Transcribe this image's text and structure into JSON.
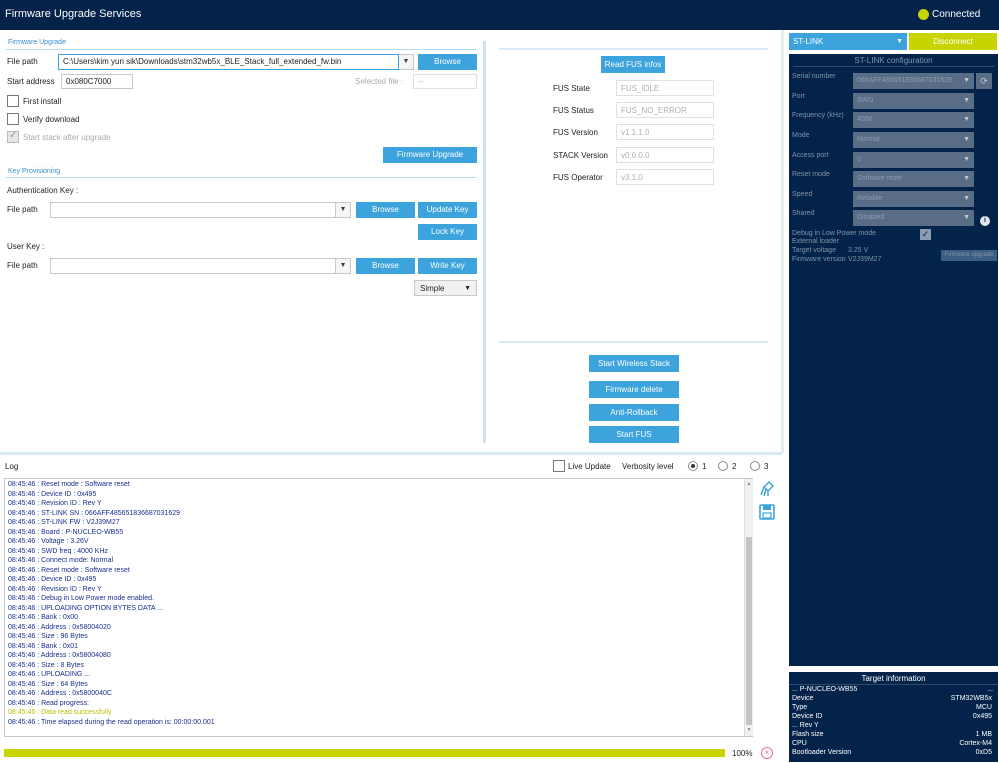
{
  "titlebar": {
    "title": "Firmware Upgrade Services",
    "status": "Connected"
  },
  "firmware_upgrade": {
    "section": "Firmware Upgrade",
    "file_path_label": "File path",
    "file_path_value": "C:\\Users\\kim yun sik\\Downloads\\stm32wb5x_BLE_Stack_full_extended_fw.bin",
    "browse": "Browse",
    "start_address_label": "Start address",
    "start_address_value": "0x080C7000",
    "selected_file_label": "Selected file :",
    "selected_file_value": "--",
    "first_install": "First install",
    "verify_download": "Verify download",
    "start_stack": "Start stack after upgrade",
    "upgrade_btn": "Firmware Upgrade"
  },
  "key_provisioning": {
    "section": "Key Provisioning",
    "auth_key_label": "Authentication Key :",
    "file_path_label": "File path",
    "browse": "Browse",
    "update_key": "Update Key",
    "lock_key": "Lock Key",
    "user_key_label": "User Key :",
    "file_path_label2": "File path",
    "browse2": "Browse",
    "write_key": "Write Key",
    "mode": "Simple"
  },
  "fus": {
    "read_btn": "Read FUS infos",
    "rows": [
      {
        "label": "FUS State",
        "value": "FUS_IDLE"
      },
      {
        "label": "FUS Status",
        "value": "FUS_NO_ERROR"
      },
      {
        "label": "FUS Version",
        "value": "v1.1.1.0"
      },
      {
        "label": "STACK Version",
        "value": "v0.0.0.0"
      },
      {
        "label": "FUS Operator",
        "value": "v3.1.0"
      }
    ],
    "start_wireless": "Start Wireless Stack",
    "fw_delete": "Firmware delete",
    "anti_rollback": "Anti-Rollback",
    "start_fus": "Start FUS"
  },
  "stlink": {
    "interface": "ST-LINK",
    "disconnect": "Disconnect",
    "config_title": "ST-LINK configuration",
    "fields": [
      {
        "label": "Serial number",
        "value": "066AFF485651836687031629"
      },
      {
        "label": "Port",
        "value": "SWD"
      },
      {
        "label": "Frequency (kHz)",
        "value": "4000"
      },
      {
        "label": "Mode",
        "value": "Normal"
      },
      {
        "label": "Access port",
        "value": "0"
      },
      {
        "label": "Reset mode",
        "value": "Software reset"
      },
      {
        "label": "Speed",
        "value": "Reliable"
      },
      {
        "label": "Shared",
        "value": "Disabled"
      }
    ],
    "debug_low_power": "Debug in Low Power mode",
    "external_loader": "External loader",
    "target_voltage_label": "Target voltage",
    "target_voltage_value": "3.25 V",
    "fw_version_label": "Firmware version",
    "fw_version_value": "V2J39M27",
    "fw_upgrade_btn": "Firmware upgrade"
  },
  "target_info": {
    "title": "Target information",
    "board_label": "...",
    "board": "P-NUCLEO-WB55",
    "board_trail": "...",
    "rows": [
      {
        "label": "Device",
        "value": "STM32WB5x"
      },
      {
        "label": "Type",
        "value": "MCU"
      },
      {
        "label": "Device ID",
        "value": "0x495"
      },
      {
        "label": "... Rev Y",
        "value": ""
      },
      {
        "label": "Flash size",
        "value": "1 MB"
      },
      {
        "label": "CPU",
        "value": "Cortex-M4"
      },
      {
        "label": "Bootloader Version",
        "value": "0xD5"
      }
    ]
  },
  "log": {
    "title": "Log",
    "live_update": "Live Update",
    "verbosity": "Verbosity level",
    "levels": [
      "1",
      "2",
      "3"
    ],
    "lines": [
      {
        "t": "08:45:46 : Reset mode  : Software reset",
        "ok": false
      },
      {
        "t": "08:45:46 : Device ID   : 0x495",
        "ok": false
      },
      {
        "t": "08:45:46 : Revision ID : Rev Y",
        "ok": false
      },
      {
        "t": "08:45:46 : ST-LINK SN  : 066AFF485651836687031629",
        "ok": false
      },
      {
        "t": "08:45:46 : ST-LINK FW  : V2J39M27",
        "ok": false
      },
      {
        "t": "08:45:46 : Board       : P-NUCLEO-WB55",
        "ok": false
      },
      {
        "t": "08:45:46 : Voltage     : 3.26V",
        "ok": false
      },
      {
        "t": "08:45:46 : SWD freq    : 4000 KHz",
        "ok": false
      },
      {
        "t": "08:45:46 : Connect mode: Normal",
        "ok": false
      },
      {
        "t": "08:45:46 : Reset mode  : Software reset",
        "ok": false
      },
      {
        "t": "08:45:46 : Device ID   : 0x495",
        "ok": false
      },
      {
        "t": "08:45:46 : Revision ID : Rev Y",
        "ok": false
      },
      {
        "t": "08:45:46 : Debug in Low Power mode enabled.",
        "ok": false
      },
      {
        "t": "08:45:46 : UPLOADING OPTION BYTES DATA ...",
        "ok": false
      },
      {
        "t": "08:45:46 :   Bank          : 0x00",
        "ok": false
      },
      {
        "t": "08:45:46 :   Address       : 0x58004020",
        "ok": false
      },
      {
        "t": "08:45:46 :   Size          : 96 Bytes",
        "ok": false
      },
      {
        "t": "08:45:46 :   Bank          : 0x01",
        "ok": false
      },
      {
        "t": "08:45:46 :   Address       : 0x58004080",
        "ok": false
      },
      {
        "t": "08:45:46 :   Size          : 8 Bytes",
        "ok": false
      },
      {
        "t": "08:45:46 : UPLOADING ...",
        "ok": false
      },
      {
        "t": "08:45:46 :   Size          : 64 Bytes",
        "ok": false
      },
      {
        "t": "08:45:46 :   Address       : 0x5800040C",
        "ok": false
      },
      {
        "t": "08:45:46 : Read progress:",
        "ok": false
      },
      {
        "t": "08:45:46 : Data read successfully",
        "ok": true
      },
      {
        "t": "08:45:46 : Time elapsed during the read operation is: 00:00:00.001",
        "ok": false
      }
    ]
  },
  "progress": {
    "value": 100,
    "label": "100%"
  },
  "colors": {
    "navy": "#03234b",
    "accent": "#3ca3dc",
    "lime": "#c8d400"
  }
}
